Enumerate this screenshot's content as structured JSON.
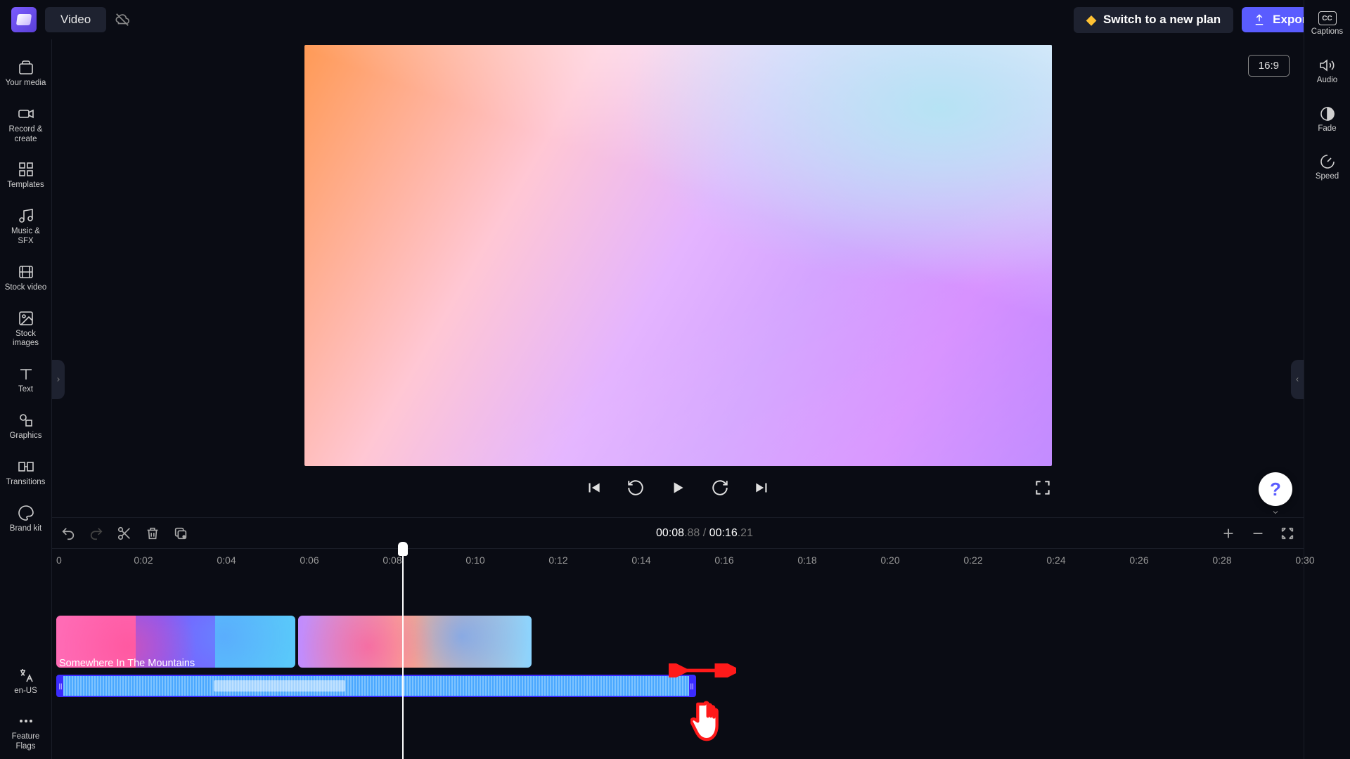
{
  "topbar": {
    "title": "Video",
    "switch_plan": "Switch to a new plan",
    "export": "Export"
  },
  "left_sidebar": [
    {
      "icon": "media",
      "label": "Your media"
    },
    {
      "icon": "record",
      "label": "Record & create"
    },
    {
      "icon": "templates",
      "label": "Templates"
    },
    {
      "icon": "music",
      "label": "Music & SFX"
    },
    {
      "icon": "stockvideo",
      "label": "Stock video"
    },
    {
      "icon": "stockimages",
      "label": "Stock images"
    },
    {
      "icon": "text",
      "label": "Text"
    },
    {
      "icon": "graphics",
      "label": "Graphics"
    },
    {
      "icon": "transitions",
      "label": "Transitions"
    },
    {
      "icon": "brandkit",
      "label": "Brand kit"
    }
  ],
  "left_bottom": [
    {
      "icon": "lang",
      "label": "en-US"
    },
    {
      "icon": "flags",
      "label": "Feature Flags"
    }
  ],
  "right_sidebar": [
    {
      "icon": "cc",
      "label": "Captions"
    },
    {
      "icon": "audio",
      "label": "Audio"
    },
    {
      "icon": "fade",
      "label": "Fade"
    },
    {
      "icon": "speed",
      "label": "Speed"
    }
  ],
  "preview": {
    "aspect": "16:9"
  },
  "timecode": {
    "current": "00:08",
    "current_frac": ".88",
    "sep": " / ",
    "total": "00:16",
    "total_frac": ".21"
  },
  "ruler_ticks": [
    "0",
    "0:02",
    "0:04",
    "0:06",
    "0:08",
    "0:10",
    "0:12",
    "0:14",
    "0:16",
    "0:18",
    "0:20",
    "0:22",
    "0:24",
    "0:26",
    "0:28",
    "0:30"
  ],
  "audio_clip_name": "Somewhere In The Mountains",
  "help": "?"
}
